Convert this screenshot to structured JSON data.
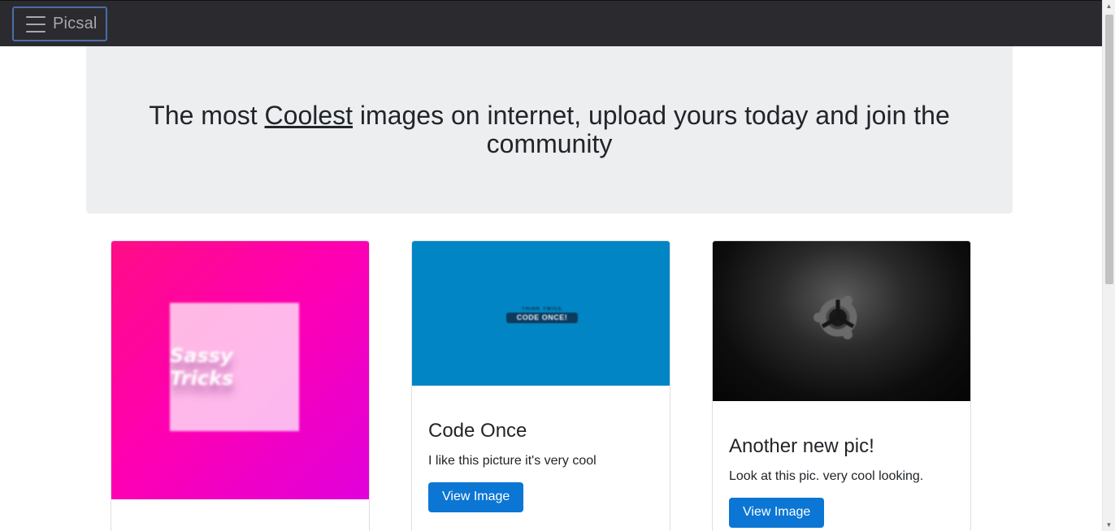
{
  "navbar": {
    "brand": "Picsal",
    "toggle_icon": "hamburger-menu-icon",
    "background": "#2b2b2f"
  },
  "hero": {
    "title_before": "The most ",
    "title_emphasis": "Coolest",
    "title_after": " images on internet, upload yours today and join the community"
  },
  "cards": [
    {
      "image_text": "Sassy Tricks",
      "title": "",
      "text": "",
      "button_label": ""
    },
    {
      "image_text_small": "THINK TWICE",
      "image_text_main": "CODE ONCE!",
      "title": "Code Once",
      "text": "I like this picture it's very cool",
      "button_label": "View Image"
    },
    {
      "image_icon": "ubuntu-logo-icon",
      "title": "Another new pic!",
      "text": "Look at this pic. very cool looking.",
      "button_label": "View Image"
    }
  ],
  "colors": {
    "accent": "#0b76d4",
    "hero_bg": "#eceef0"
  }
}
